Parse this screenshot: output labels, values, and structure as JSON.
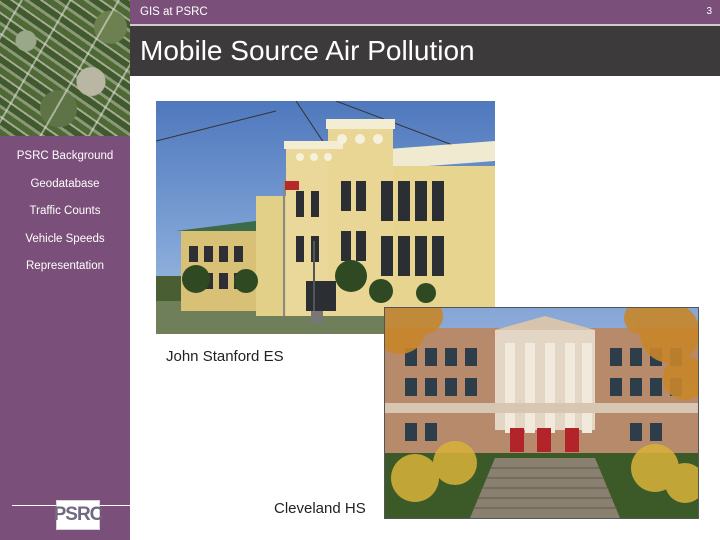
{
  "header": {
    "breadcrumb": "GIS at PSRC",
    "page_number": "3",
    "title": "Mobile Source Air Pollution"
  },
  "sidebar": {
    "items": [
      {
        "label": "PSRC Background"
      },
      {
        "label": "Geodatabase"
      },
      {
        "label": "Traffic Counts"
      },
      {
        "label": "Vehicle Speeds"
      },
      {
        "label": "Representation"
      }
    ],
    "logo_text": "PSRC"
  },
  "photos": {
    "school1_caption": "John Stanford ES",
    "school2_caption": "Cleveland HS"
  },
  "colors": {
    "sidebar": "#7a4f79",
    "header": "#3c3a3b"
  }
}
